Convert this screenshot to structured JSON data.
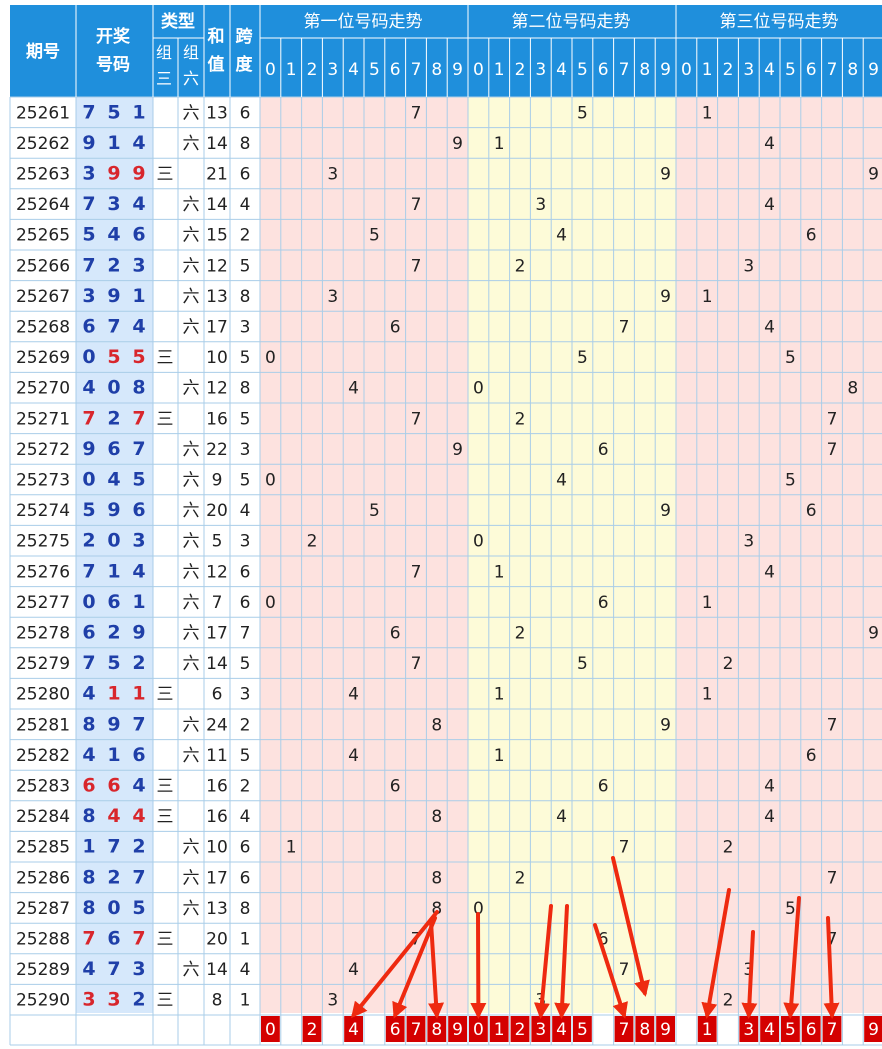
{
  "header": {
    "period": "期号",
    "draw_line1": "开奖",
    "draw_line2": "号码",
    "type": "类型",
    "type_g3_line1": "组",
    "type_g3_line2": "三",
    "type_g6_line1": "组",
    "type_g6_line2": "六",
    "sum_line1": "和",
    "sum_line2": "值",
    "span_line1": "跨",
    "span_line2": "度",
    "pos1": "第一位号码走势",
    "pos2": "第二位号码走势",
    "pos3": "第三位号码走势",
    "digits": [
      "0",
      "1",
      "2",
      "3",
      "4",
      "5",
      "6",
      "7",
      "8",
      "9"
    ]
  },
  "rows": [
    {
      "period": "25261",
      "d": [
        "7",
        "5",
        "1"
      ],
      "g3": "",
      "g6": "六",
      "sum": "13",
      "span": "6"
    },
    {
      "period": "25262",
      "d": [
        "9",
        "1",
        "4"
      ],
      "g3": "",
      "g6": "六",
      "sum": "14",
      "span": "8"
    },
    {
      "period": "25263",
      "d": [
        "3",
        "9",
        "9"
      ],
      "g3": "三",
      "g6": "",
      "sum": "21",
      "span": "6"
    },
    {
      "period": "25264",
      "d": [
        "7",
        "3",
        "4"
      ],
      "g3": "",
      "g6": "六",
      "sum": "14",
      "span": "4"
    },
    {
      "period": "25265",
      "d": [
        "5",
        "4",
        "6"
      ],
      "g3": "",
      "g6": "六",
      "sum": "15",
      "span": "2"
    },
    {
      "period": "25266",
      "d": [
        "7",
        "2",
        "3"
      ],
      "g3": "",
      "g6": "六",
      "sum": "12",
      "span": "5"
    },
    {
      "period": "25267",
      "d": [
        "3",
        "9",
        "1"
      ],
      "g3": "",
      "g6": "六",
      "sum": "13",
      "span": "8"
    },
    {
      "period": "25268",
      "d": [
        "6",
        "7",
        "4"
      ],
      "g3": "",
      "g6": "六",
      "sum": "17",
      "span": "3"
    },
    {
      "period": "25269",
      "d": [
        "0",
        "5",
        "5"
      ],
      "g3": "三",
      "g6": "",
      "sum": "10",
      "span": "5"
    },
    {
      "period": "25270",
      "d": [
        "4",
        "0",
        "8"
      ],
      "g3": "",
      "g6": "六",
      "sum": "12",
      "span": "8"
    },
    {
      "period": "25271",
      "d": [
        "7",
        "2",
        "7"
      ],
      "g3": "三",
      "g6": "",
      "sum": "16",
      "span": "5"
    },
    {
      "period": "25272",
      "d": [
        "9",
        "6",
        "7"
      ],
      "g3": "",
      "g6": "六",
      "sum": "22",
      "span": "3"
    },
    {
      "period": "25273",
      "d": [
        "0",
        "4",
        "5"
      ],
      "g3": "",
      "g6": "六",
      "sum": "9",
      "span": "5"
    },
    {
      "period": "25274",
      "d": [
        "5",
        "9",
        "6"
      ],
      "g3": "",
      "g6": "六",
      "sum": "20",
      "span": "4"
    },
    {
      "period": "25275",
      "d": [
        "2",
        "0",
        "3"
      ],
      "g3": "",
      "g6": "六",
      "sum": "5",
      "span": "3"
    },
    {
      "period": "25276",
      "d": [
        "7",
        "1",
        "4"
      ],
      "g3": "",
      "g6": "六",
      "sum": "12",
      "span": "6"
    },
    {
      "period": "25277",
      "d": [
        "0",
        "6",
        "1"
      ],
      "g3": "",
      "g6": "六",
      "sum": "7",
      "span": "6"
    },
    {
      "period": "25278",
      "d": [
        "6",
        "2",
        "9"
      ],
      "g3": "",
      "g6": "六",
      "sum": "17",
      "span": "7"
    },
    {
      "period": "25279",
      "d": [
        "7",
        "5",
        "2"
      ],
      "g3": "",
      "g6": "六",
      "sum": "14",
      "span": "5"
    },
    {
      "period": "25280",
      "d": [
        "4",
        "1",
        "1"
      ],
      "g3": "三",
      "g6": "",
      "sum": "6",
      "span": "3"
    },
    {
      "period": "25281",
      "d": [
        "8",
        "9",
        "7"
      ],
      "g3": "",
      "g6": "六",
      "sum": "24",
      "span": "2"
    },
    {
      "period": "25282",
      "d": [
        "4",
        "1",
        "6"
      ],
      "g3": "",
      "g6": "六",
      "sum": "11",
      "span": "5"
    },
    {
      "period": "25283",
      "d": [
        "6",
        "6",
        "4"
      ],
      "g3": "三",
      "g6": "",
      "sum": "16",
      "span": "2"
    },
    {
      "period": "25284",
      "d": [
        "8",
        "4",
        "4"
      ],
      "g3": "三",
      "g6": "",
      "sum": "16",
      "span": "4"
    },
    {
      "period": "25285",
      "d": [
        "1",
        "7",
        "2"
      ],
      "g3": "",
      "g6": "六",
      "sum": "10",
      "span": "6"
    },
    {
      "period": "25286",
      "d": [
        "8",
        "2",
        "7"
      ],
      "g3": "",
      "g6": "六",
      "sum": "17",
      "span": "6"
    },
    {
      "period": "25287",
      "d": [
        "8",
        "0",
        "5"
      ],
      "g3": "",
      "g6": "六",
      "sum": "13",
      "span": "8"
    },
    {
      "period": "25288",
      "d": [
        "7",
        "6",
        "7"
      ],
      "g3": "三",
      "g6": "",
      "sum": "20",
      "span": "1"
    },
    {
      "period": "25289",
      "d": [
        "4",
        "7",
        "3"
      ],
      "g3": "",
      "g6": "六",
      "sum": "14",
      "span": "4"
    },
    {
      "period": "25290",
      "d": [
        "3",
        "3",
        "2"
      ],
      "g3": "三",
      "g6": "",
      "sum": "8",
      "span": "1"
    }
  ],
  "predictions": {
    "pos1": [
      "0",
      "2",
      "4",
      "6",
      "7",
      "8",
      "9"
    ],
    "pos2": [
      "0",
      "1",
      "2",
      "3",
      "4",
      "5",
      "7",
      "8",
      "9"
    ],
    "pos3": [
      "1",
      "3",
      "4",
      "5",
      "6",
      "7",
      "9"
    ]
  },
  "colors": {
    "header_blue": "#1f8fdc",
    "pos1_bg": "#fde2df",
    "pos2_bg": "#fdfbd8",
    "pos3_bg": "#fde2df",
    "draw_bg": "#d6e8fb",
    "draw_normal": "#1f3fa8",
    "draw_repeat": "#d8262c",
    "grid_line": "#a9cde8",
    "prediction_red": "#d40000",
    "arrow_red": "#ee2a10"
  }
}
